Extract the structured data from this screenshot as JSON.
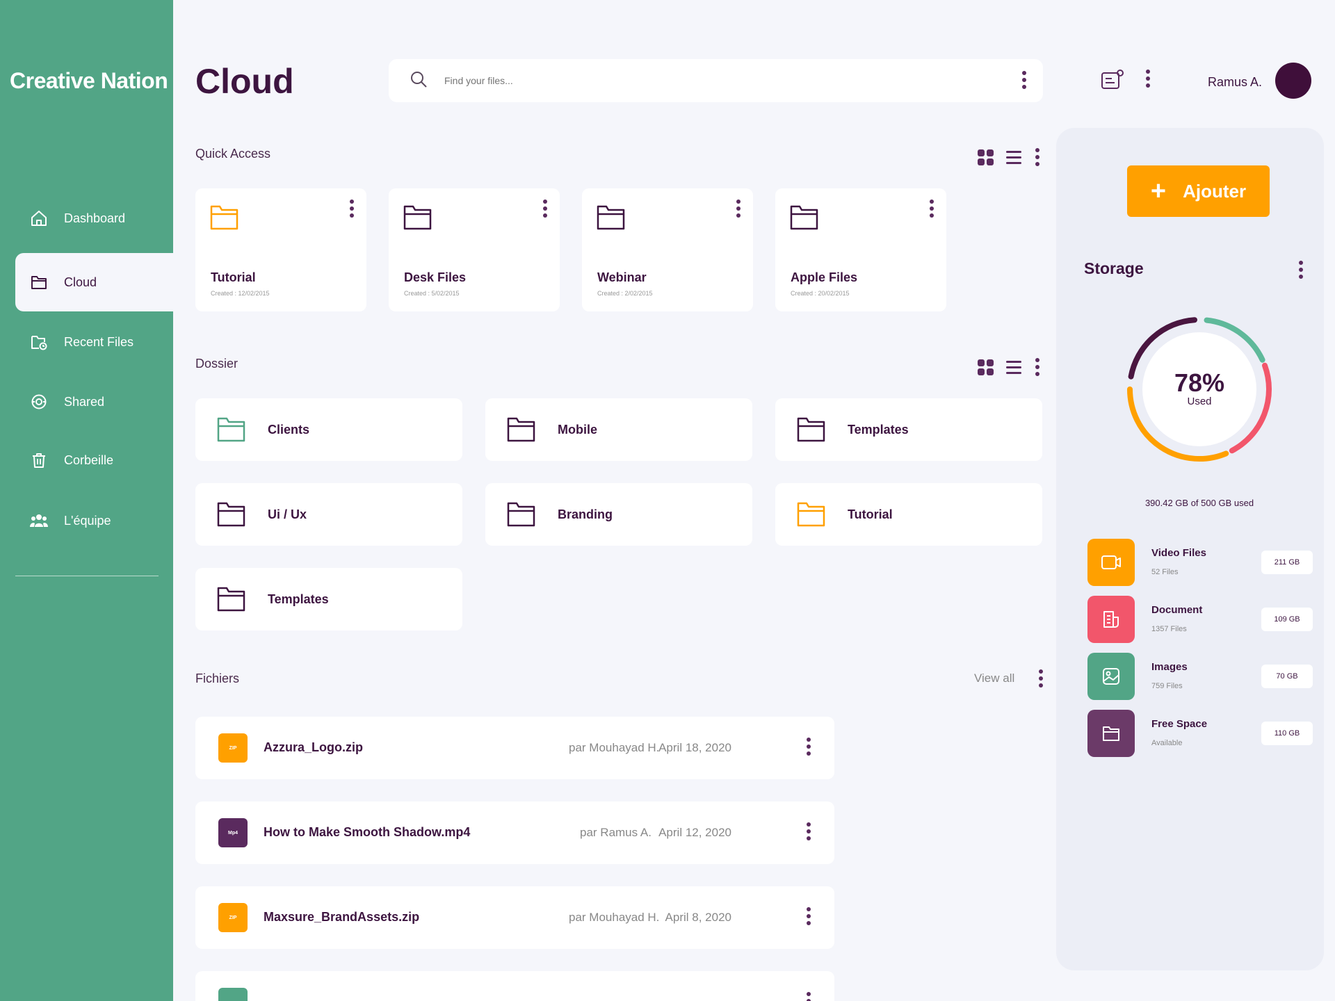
{
  "brand": "Creative Nation",
  "sidebar": {
    "items": [
      {
        "label": "Dashboard"
      },
      {
        "label": "Cloud"
      },
      {
        "label": "Recent Files"
      },
      {
        "label": "Shared"
      },
      {
        "label": "Corbeille"
      },
      {
        "label": "L'équipe"
      }
    ],
    "active": "Cloud"
  },
  "header": {
    "title": "Cloud",
    "search_placeholder": "Find your files...",
    "user_name": "Ramus A."
  },
  "quick_access": {
    "label": "Quick Access",
    "cards": [
      {
        "name": "Tutorial",
        "created": "Created : 12/02/2015",
        "color": "#ffa000"
      },
      {
        "name": "Desk Files",
        "created": "Created : 5/02/2015",
        "color": "#3d1540"
      },
      {
        "name": "Webinar",
        "created": "Created : 2/02/2015",
        "color": "#3d1540"
      },
      {
        "name": "Apple Files",
        "created": "Created : 20/02/2015",
        "color": "#3d1540"
      }
    ]
  },
  "dossier": {
    "label": "Dossier",
    "folders": [
      {
        "name": "Clients",
        "color": "#52a586"
      },
      {
        "name": "Mobile",
        "color": "#3d1540"
      },
      {
        "name": "Templates",
        "color": "#3d1540"
      },
      {
        "name": "Ui / Ux",
        "color": "#3d1540"
      },
      {
        "name": "Branding",
        "color": "#3d1540"
      },
      {
        "name": "Tutorial",
        "color": "#ffa000"
      },
      {
        "name": "Templates",
        "color": "#3d1540"
      }
    ]
  },
  "fichiers": {
    "label": "Fichiers",
    "view_all": "View all",
    "files": [
      {
        "badge": "ZIP",
        "badge_color": "#ffa000",
        "name": "Azzura_Logo.zip",
        "owner": "par Mouhayad H.",
        "date": "April 18, 2020"
      },
      {
        "badge": "Mp4",
        "badge_color": "#5a2a5e",
        "name": "How to Make Smooth Shadow.mp4",
        "owner": "par Ramus A.",
        "date": "April 12, 2020"
      },
      {
        "badge": "ZIP",
        "badge_color": "#ffa000",
        "name": "Maxsure_BrandAssets.zip",
        "owner": "par Mouhayad H.",
        "date": "April 8, 2020"
      }
    ]
  },
  "storage": {
    "add_label": "Ajouter",
    "title": "Storage",
    "percent_label": "78%",
    "percent_used": 78,
    "used_label": "Used",
    "used_text": "390.42 GB of 500 GB used",
    "categories": [
      {
        "name": "Video Files",
        "sub": "52 Files",
        "size": "211 GB",
        "color": "#ffa000",
        "icon": "video-icon"
      },
      {
        "name": "Document",
        "sub": "1357 Files",
        "size": "109 GB",
        "color": "#f2566b",
        "icon": "document-icon"
      },
      {
        "name": "Images",
        "sub": "759 Files",
        "size": "70 GB",
        "color": "#52a586",
        "icon": "image-icon"
      },
      {
        "name": "Free Space",
        "sub": "Available",
        "size": "110 GB",
        "color": "#6b3a68",
        "icon": "folder-icon"
      }
    ]
  }
}
